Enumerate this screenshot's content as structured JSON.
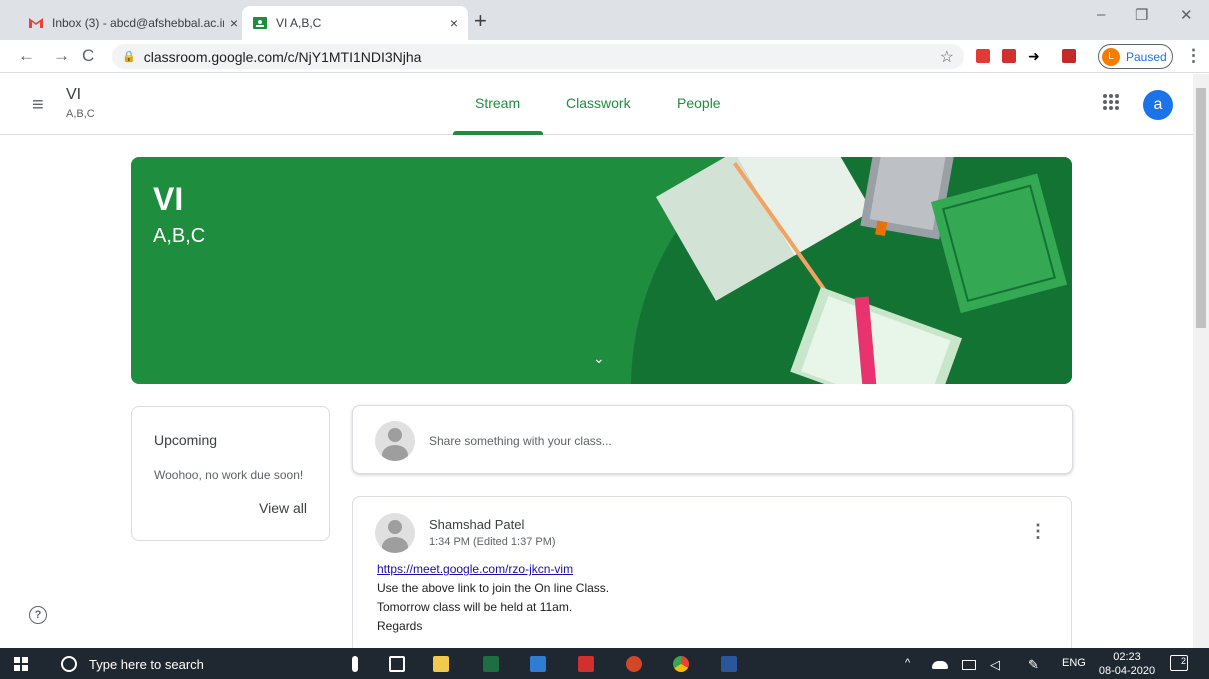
{
  "browser": {
    "tabs": [
      {
        "label": "Inbox (3) - abcd@afshebbal.ac.in",
        "close": "×"
      },
      {
        "label": "VI A,B,C",
        "close": "×"
      }
    ],
    "new_tab": "+",
    "url": "classroom.google.com/c/NjY1MTI1NDI3Njha",
    "profile": {
      "initial": "L",
      "label": "Paused"
    },
    "nav": {
      "back": "←",
      "forward": "→",
      "reload": "C",
      "star": "☆",
      "menu": "⋮"
    },
    "window": {
      "minimize": "–",
      "restore": "❐",
      "close": "✕"
    }
  },
  "header": {
    "menu_icon": "≡",
    "class_title": "VI",
    "class_section": "A,B,C",
    "tabs": [
      "Stream",
      "Classwork",
      "People"
    ],
    "active_tab": "Stream",
    "user_initial": "a"
  },
  "banner": {
    "title": "VI",
    "subtitle": "A,B,C",
    "expand_icon": "⌄",
    "bg_color": "#1e8e3e"
  },
  "upcoming": {
    "heading": "Upcoming",
    "text": "Woohoo, no work due soon!",
    "view_all": "View all"
  },
  "share": {
    "placeholder": "Share something with your class..."
  },
  "post": {
    "author": "Shamshad Patel",
    "time": "1:34 PM (Edited 1:37 PM)",
    "more_icon": "⋮",
    "link": "https://meet.google.com/rzo-jkcn-vim",
    "lines": [
      "Use the above link to join the On line Class.",
      "Tomorrow class will be held at 11am.",
      "Regards"
    ]
  },
  "help_icon": "?",
  "taskbar": {
    "search_placeholder": "Type here to search",
    "tray": {
      "up_arrow": "^",
      "lang": "ENG",
      "time": "02:23",
      "date": "08-04-2020",
      "notifications": "2"
    }
  },
  "colors": {
    "accent_green": "#1e8e3e",
    "user_blue": "#1a73e8"
  }
}
